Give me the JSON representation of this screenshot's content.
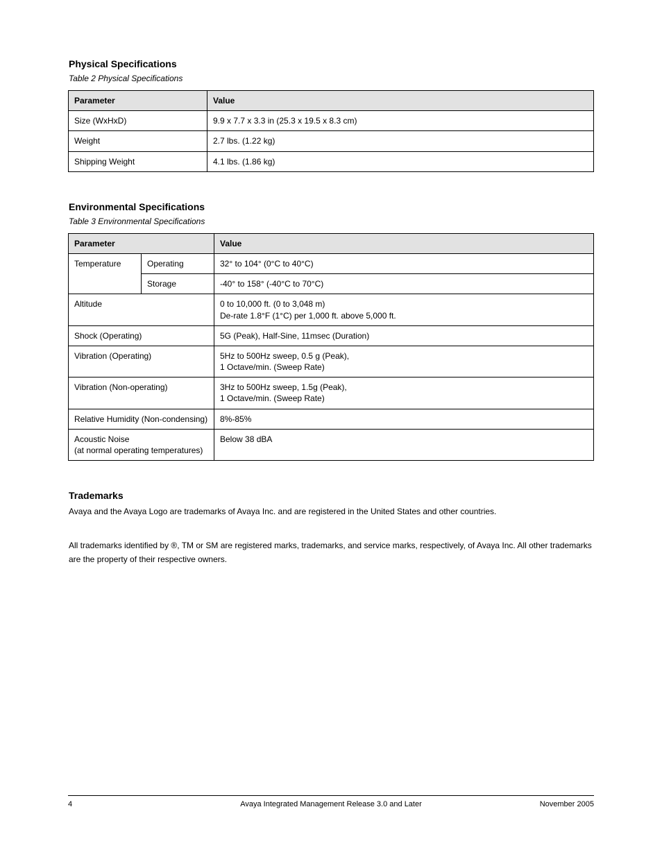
{
  "section_physical": {
    "title": "Physical Specifications",
    "caption": "Table 2  Physical Specifications",
    "headers": [
      "Parameter",
      "Value"
    ],
    "rows": [
      [
        "Size (WxHxD)",
        "9.9 x 7.7 x 3.3 in (25.3 x 19.5 x 8.3 cm)"
      ],
      [
        "Weight",
        "2.7 lbs. (1.22 kg)"
      ],
      [
        "Shipping Weight",
        "4.1 lbs. (1.86 kg)"
      ]
    ]
  },
  "section_env": {
    "title": "Environmental Specifications",
    "caption": "Table 3  Environmental Specifications",
    "headers": [
      "Parameter",
      "Value"
    ],
    "rows": [
      {
        "label": "Temperature",
        "sublabel": "Operating",
        "value": "32° to 104° (0°C to 40°C)"
      },
      {
        "label": "",
        "sublabel": "Storage",
        "value": "-40° to 158° (-40°C to 70°C)"
      },
      {
        "label": "Altitude",
        "value": "0 to 10,000 ft. (0 to 3,048 m)\nDe-rate 1.8°F (1°C) per 1,000 ft. above 5,000 ft."
      },
      {
        "label": "Shock (Operating)",
        "value": "5G (Peak), Half-Sine, 11msec (Duration)"
      },
      {
        "label": "Vibration (Operating)",
        "value": "5Hz to 500Hz sweep, 0.5 g (Peak),\n1 Octave/min. (Sweep Rate)"
      },
      {
        "label": "Vibration (Non-operating)",
        "value": "3Hz to 500Hz sweep, 1.5g (Peak),\n1 Octave/min. (Sweep Rate)"
      },
      {
        "label": "Relative Humidity (Non-condensing)",
        "value": "8%-85%"
      },
      {
        "label": "Acoustic Noise\n(at normal operating temperatures)",
        "value": "Below 38 dBA"
      }
    ]
  },
  "section_trademarks": {
    "title": "Trademarks",
    "intro": "Avaya and the Avaya Logo are trademarks of Avaya Inc. and are registered in the United States and other countries.",
    "body": "All trademarks identified by ®, TM or SM are registered marks, trademarks, and service marks, respectively, of Avaya Inc. All other trademarks are the property of their respective owners."
  },
  "footer": {
    "left": "4",
    "center": "Avaya Integrated Management Release 3.0 and Later",
    "right": "November 2005"
  }
}
